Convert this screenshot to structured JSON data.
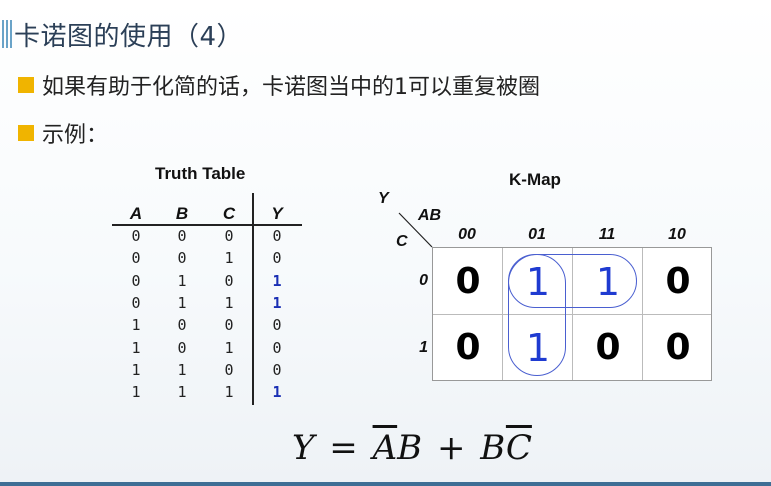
{
  "title": "卡诺图的使用（4）",
  "bullets": [
    "如果有助于化简的话，卡诺图当中的1可以重复被圈",
    "示例："
  ],
  "truth_table": {
    "title": "Truth Table",
    "headers": [
      "A",
      "B",
      "C",
      "Y"
    ],
    "rows": [
      [
        "0",
        "0",
        "0",
        "0"
      ],
      [
        "0",
        "0",
        "1",
        "0"
      ],
      [
        "0",
        "1",
        "0",
        "1"
      ],
      [
        "0",
        "1",
        "1",
        "1"
      ],
      [
        "1",
        "0",
        "0",
        "0"
      ],
      [
        "1",
        "0",
        "1",
        "0"
      ],
      [
        "1",
        "1",
        "0",
        "0"
      ],
      [
        "1",
        "1",
        "1",
        "1"
      ]
    ]
  },
  "kmap": {
    "title": "K-Map",
    "output_label": "Y",
    "col_var": "AB",
    "row_var": "C",
    "col_headers": [
      "00",
      "01",
      "11",
      "10"
    ],
    "row_headers": [
      "0",
      "1"
    ],
    "cells": [
      [
        "0",
        "1",
        "1",
        "0"
      ],
      [
        "0",
        "1",
        "0",
        "0"
      ]
    ],
    "groups": [
      "C'=0 row, AB=01 and 11",
      "AB=01 column, C=0 and 1"
    ]
  },
  "formula": {
    "lhs": "Y",
    "eq": "=",
    "t1_bar": "A",
    "t1_rest": "B",
    "plus": "+",
    "t2_a": "B",
    "t2_bar": "C"
  },
  "colors": {
    "bullet": "#f0b400",
    "title_text": "#2b3f57",
    "kmap_one": "#1f3bd1",
    "group_ring": "#4a5fd0"
  }
}
